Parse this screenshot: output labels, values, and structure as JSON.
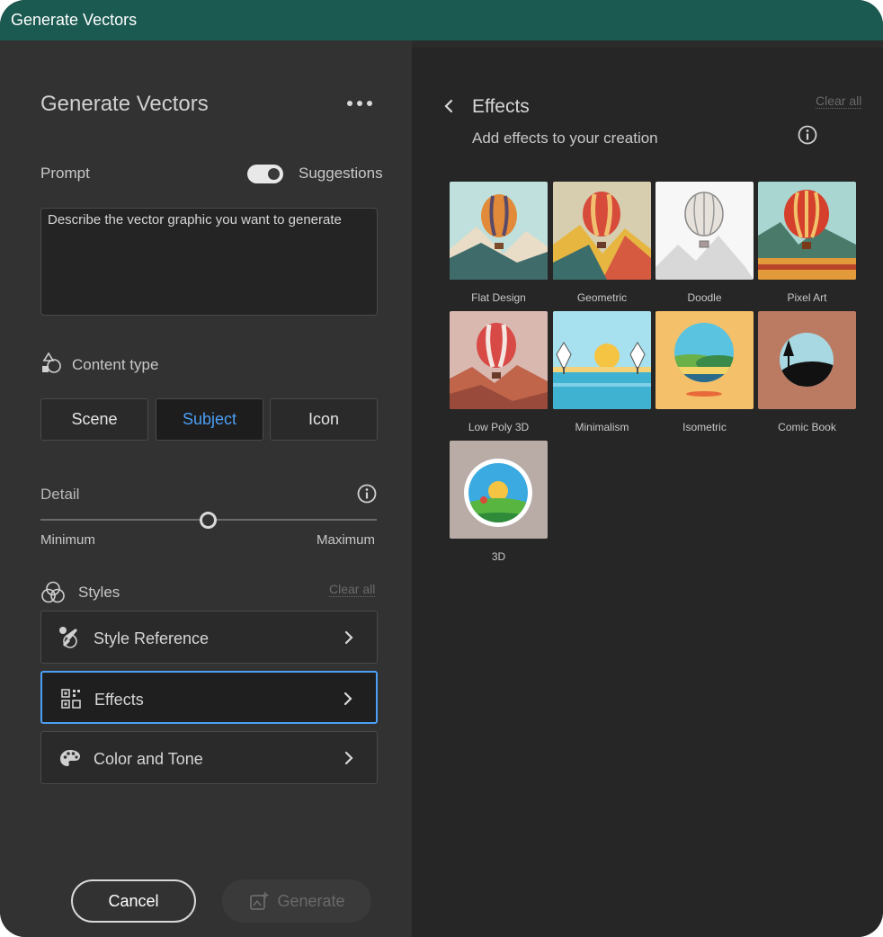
{
  "window": {
    "title": "Generate Vectors"
  },
  "left_panel": {
    "title": "Generate Vectors",
    "prompt": {
      "label": "Prompt",
      "suggestions_label": "Suggestions",
      "suggestions_on": true,
      "placeholder": "Describe the vector graphic you want to generate",
      "value": ""
    },
    "content_type": {
      "label": "Content type",
      "options": [
        "Scene",
        "Subject",
        "Icon"
      ],
      "selected": "Subject"
    },
    "detail": {
      "label": "Detail",
      "min_label": "Minimum",
      "max_label": "Maximum",
      "level": 0.5
    },
    "styles": {
      "label": "Styles",
      "clear_label": "Clear all",
      "rows": [
        {
          "label": "Style Reference",
          "icon": "brush-icon"
        },
        {
          "label": "Effects",
          "icon": "qr-grid-icon",
          "active": true
        },
        {
          "label": "Color and Tone",
          "icon": "palette-icon"
        }
      ]
    },
    "actions": {
      "cancel": "Cancel",
      "generate": "Generate"
    }
  },
  "effects_panel": {
    "title": "Effects",
    "subtitle": "Add effects to your creation",
    "clear_label": "Clear all",
    "items": [
      "Flat Design",
      "Geometric",
      "Doodle",
      "Pixel Art",
      "Low Poly 3D",
      "Minimalism",
      "Isometric",
      "Comic Book",
      "3D"
    ]
  },
  "colors": {
    "titlebar": "#1a5a50",
    "accent": "#4c9ff5",
    "left_bg": "#323232",
    "right_bg": "#262626"
  }
}
